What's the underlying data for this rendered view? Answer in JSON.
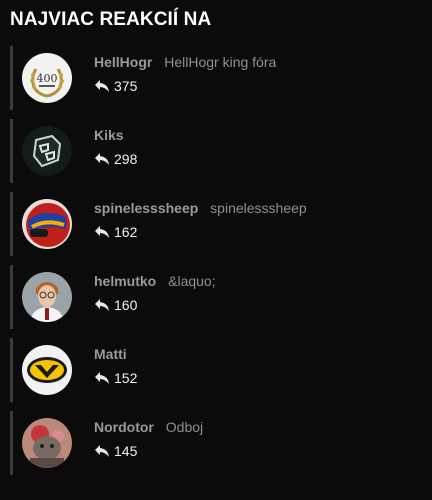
{
  "header": {
    "title": "NAJVIAC REAKCIÍ NA"
  },
  "users": [
    {
      "name": "HellHogr",
      "title": "HellHogr king fóra",
      "replies": "375",
      "avatar_icon": "laurel-400-badge-icon"
    },
    {
      "name": "Kiks",
      "title": "",
      "replies": "298",
      "avatar_icon": "game-logo-icon"
    },
    {
      "name": "spinelesssheep",
      "title": "spinelesssheep",
      "replies": "162",
      "avatar_icon": "racing-helmet-icon"
    },
    {
      "name": "helmutko",
      "title": "&laquo;",
      "replies": "160",
      "avatar_icon": "person-photo-icon"
    },
    {
      "name": "Matti",
      "title": "",
      "replies": "152",
      "avatar_icon": "yellow-logo-icon"
    },
    {
      "name": "Nordotor",
      "title": "Odboj",
      "replies": "145",
      "avatar_icon": "creature-photo-icon"
    }
  ],
  "colors": {
    "background": "#0b0b0b",
    "username": "#9a9a9a",
    "title_text": "#8f8f8f",
    "accent_bar": "#3a3a3a"
  }
}
